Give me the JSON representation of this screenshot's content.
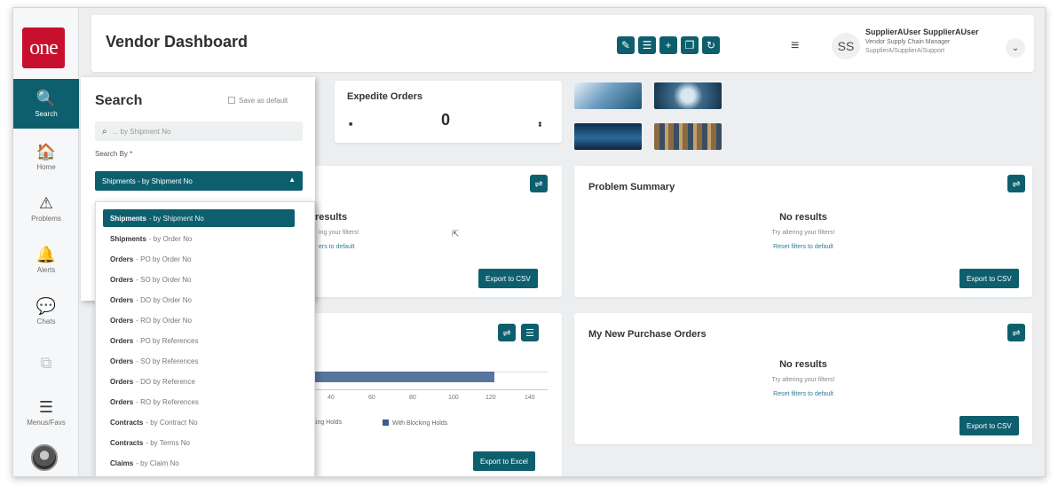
{
  "app": {
    "logo_text": "one",
    "page_title": "Vendor Dashboard"
  },
  "nav": [
    {
      "id": "search",
      "label": "Search",
      "icon": "search-icon",
      "glyph": "🔍"
    },
    {
      "id": "home",
      "label": "Home",
      "icon": "home-icon",
      "glyph": "🏠"
    },
    {
      "id": "problems",
      "label": "Problems",
      "icon": "warning-icon",
      "glyph": "⚠"
    },
    {
      "id": "alerts",
      "label": "Alerts",
      "icon": "bell-icon",
      "glyph": "🔔"
    },
    {
      "id": "chats",
      "label": "Chats",
      "icon": "chat-icon",
      "glyph": "💬"
    },
    {
      "id": "disabled",
      "label": "",
      "icon": "copy-icon",
      "glyph": "⧉"
    },
    {
      "id": "menus",
      "label": "Menus/Favs",
      "icon": "menu-icon",
      "glyph": "☰"
    }
  ],
  "toolbar": {
    "buttons": [
      {
        "icon": "pencil-icon",
        "glyph": "✎"
      },
      {
        "icon": "list-icon",
        "glyph": "☰"
      },
      {
        "icon": "plus-icon",
        "glyph": "+"
      },
      {
        "icon": "copy-icon",
        "glyph": "❐"
      },
      {
        "icon": "refresh-icon",
        "glyph": "↻"
      }
    ],
    "hamburger": "≡"
  },
  "user": {
    "initials": "SS",
    "name": "SupplierAUser SupplierAUser",
    "role": "Vendor Supply Chain Manager",
    "org": "SupplierA/SupplierA/Support",
    "caret": "⌄"
  },
  "expedite": {
    "title": "Expedite Orders",
    "value": "0",
    "left_marker": "■",
    "right_marker": "⬍"
  },
  "results_card": {
    "no_results": "results",
    "hint": "ing your filters!",
    "link": "ers to default",
    "export_label": "Export to CSV"
  },
  "problem_summary": {
    "title": "Problem Summary",
    "no_results": "No results",
    "hint": "Try altering your filters!",
    "link": "Reset filters to default",
    "export_label": "Export to CSV"
  },
  "holds_chart": {
    "ticks": [
      "40",
      "60",
      "80",
      "100",
      "120",
      "140"
    ],
    "legend_partial": "ocking Holds",
    "legend_full": "With Blocking Holds",
    "export_label": "Export to Excel"
  },
  "purchase_orders": {
    "title": "My New Purchase Orders",
    "no_results": "No results",
    "hint": "Try altering your filters!",
    "link": "Reset filters to default",
    "export_label": "Export to CSV"
  },
  "search_panel": {
    "title": "Search",
    "save_default": "Save as default",
    "input_placeholder": "... by Shipment No",
    "search_by_label": "Search By *",
    "selected_value": "Shipments - by Shipment No"
  },
  "dropdown_options": [
    {
      "entity": "Shipments",
      "rest": "- by Shipment No",
      "selected": true
    },
    {
      "entity": "Shipments",
      "rest": "- by Order No"
    },
    {
      "entity": "Orders",
      "rest": "- PO by Order No"
    },
    {
      "entity": "Orders",
      "rest": "- SO by Order No"
    },
    {
      "entity": "Orders",
      "rest": "- DO by Order No"
    },
    {
      "entity": "Orders",
      "rest": "- RO by Order No"
    },
    {
      "entity": "Orders",
      "rest": "- PO by References"
    },
    {
      "entity": "Orders",
      "rest": "- SO by References"
    },
    {
      "entity": "Orders",
      "rest": "- DO by Reference"
    },
    {
      "entity": "Orders",
      "rest": "- RO by References"
    },
    {
      "entity": "Contracts",
      "rest": "- by Contract No"
    },
    {
      "entity": "Contracts",
      "rest": "- by Terms No"
    },
    {
      "entity": "Claims",
      "rest": "- by Claim No"
    }
  ],
  "colors": {
    "accent": "#0e5f6e",
    "logo_red": "#c8102e",
    "bar": "#3b5d8c"
  }
}
